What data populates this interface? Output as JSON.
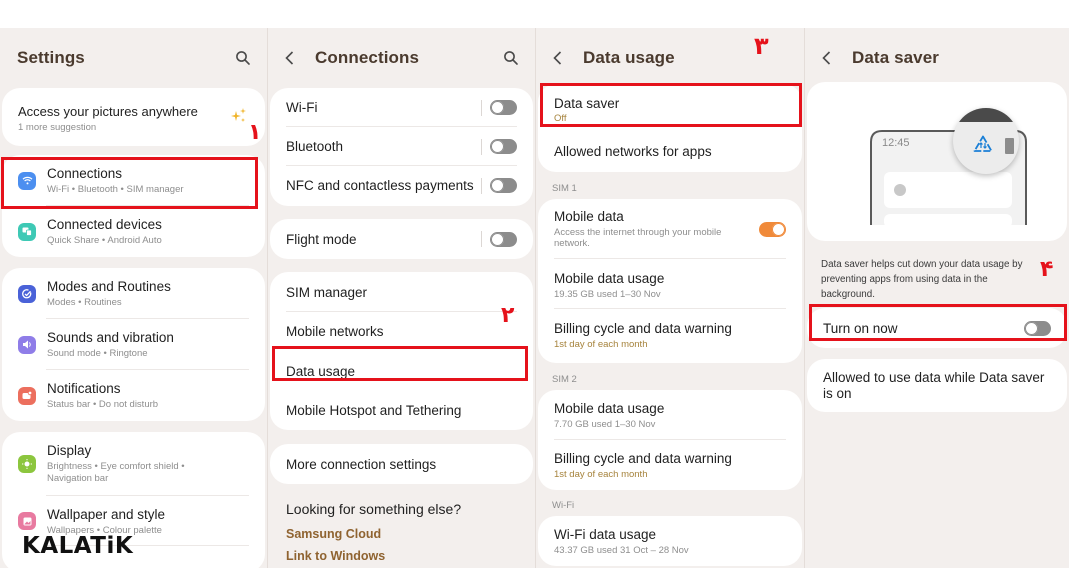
{
  "panels": {
    "settings": {
      "title": "Settings",
      "suggestion": {
        "title": "Access your pictures anywhere",
        "subtitle": "1 more suggestion"
      },
      "items": [
        {
          "label": "Connections",
          "subtitle": "Wi-Fi  •  Bluetooth  •  SIM manager",
          "icon": "wifi-icon",
          "color": "#4c8ff0"
        },
        {
          "label": "Connected devices",
          "subtitle": "Quick Share  •  Android Auto",
          "icon": "connected-devices-icon",
          "color": "#3ec9b5"
        },
        {
          "label": "Modes and Routines",
          "subtitle": "Modes  •  Routines",
          "icon": "modes-icon",
          "color": "#4a62d8"
        },
        {
          "label": "Sounds and vibration",
          "subtitle": "Sound mode  •  Ringtone",
          "icon": "sound-icon",
          "color": "#8f7de8"
        },
        {
          "label": "Notifications",
          "subtitle": "Status bar  •  Do not disturb",
          "icon": "notifications-icon",
          "color": "#ec6f5e"
        },
        {
          "label": "Display",
          "subtitle": "Brightness  •  Eye comfort shield  •  Navigation bar",
          "icon": "display-icon",
          "color": "#8cc63e"
        },
        {
          "label": "Wallpaper and style",
          "subtitle": "Wallpapers  •  Colour palette",
          "icon": "wallpaper-icon",
          "color": "#e87aa0"
        }
      ]
    },
    "connections": {
      "title": "Connections",
      "group1": [
        {
          "label": "Wi-Fi",
          "toggle": false
        },
        {
          "label": "Bluetooth",
          "toggle": false
        },
        {
          "label": "NFC and contactless payments",
          "toggle": false
        }
      ],
      "flight_mode": {
        "label": "Flight mode",
        "toggle": false
      },
      "group2": [
        {
          "label": "SIM manager"
        },
        {
          "label": "Mobile networks"
        },
        {
          "label": "Data usage"
        },
        {
          "label": "Mobile Hotspot and Tethering"
        }
      ],
      "more": "More connection settings",
      "looking": "Looking for something else?",
      "links": [
        "Samsung Cloud",
        "Link to Windows"
      ]
    },
    "data_usage": {
      "title": "Data usage",
      "data_saver": {
        "label": "Data saver",
        "value": "Off"
      },
      "allowed_networks": "Allowed networks for apps",
      "sim1": {
        "header": "SIM 1",
        "mobile_data": {
          "label": "Mobile data",
          "subtitle": "Access the internet through your mobile network.",
          "toggle": true
        },
        "usage": {
          "label": "Mobile data usage",
          "subtitle": "19.35 GB used 1–30 Nov"
        },
        "billing": {
          "label": "Billing cycle and data warning",
          "subtitle": "1st day of each month"
        }
      },
      "sim2": {
        "header": "SIM 2",
        "usage": {
          "label": "Mobile data usage",
          "subtitle": "7.70 GB used 1–30 Nov"
        },
        "billing": {
          "label": "Billing cycle and data warning",
          "subtitle": "1st day of each month"
        }
      },
      "wifi": {
        "header": "Wi-Fi",
        "usage": {
          "label": "Wi-Fi data usage",
          "subtitle": "43.37 GB used 31 Oct – 28 Nov"
        }
      }
    },
    "data_saver": {
      "title": "Data saver",
      "illustration_time": "12:45",
      "description": "Data saver helps cut down your data usage by preventing apps from using data in the background.",
      "turn_on": {
        "label": "Turn on now",
        "toggle": false
      },
      "allowed": "Allowed to use data while Data saver is on"
    }
  },
  "annotations": {
    "step1": "١",
    "step2": "٢",
    "step3": "٣",
    "step4": "۴"
  },
  "watermark": "KALATiK",
  "colors": {
    "highlight": "#e5121b",
    "toggle_on": "#f08a3a",
    "header_text": "#4a3a2e",
    "accent_link": "#a6833c"
  }
}
